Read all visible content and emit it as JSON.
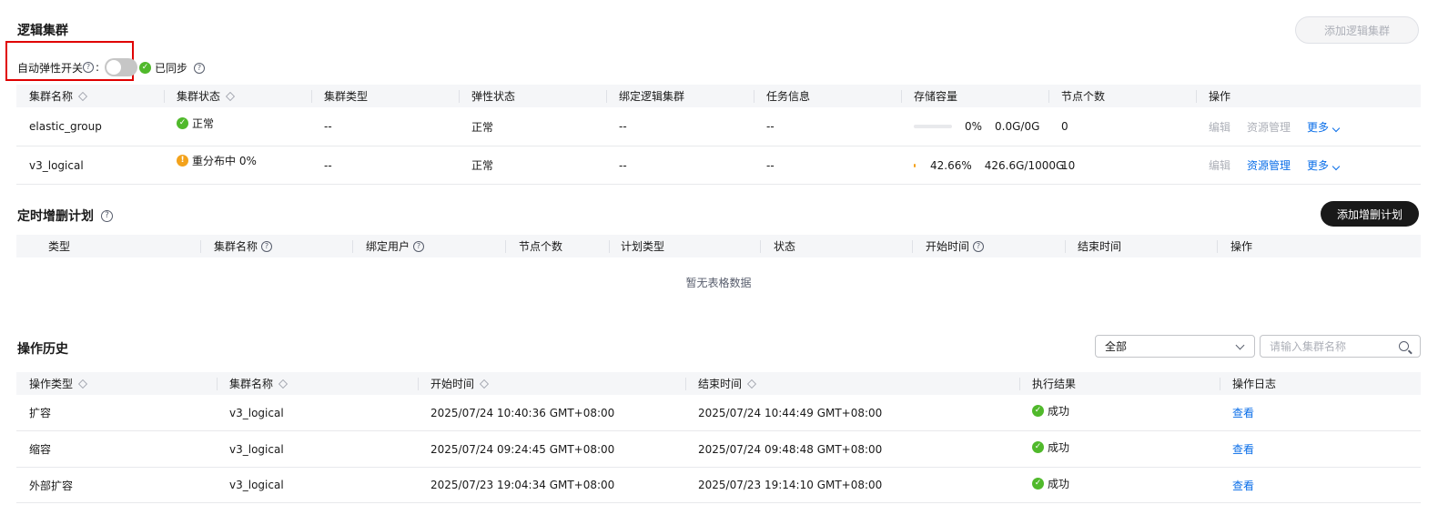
{
  "logical_cluster": {
    "title": "逻辑集群",
    "add_button": "添加逻辑集群",
    "auto_scaling_label": "自动弹性开关",
    "colon": ":",
    "sync_status": "已同步",
    "columns": [
      "集群名称",
      "集群状态",
      "集群类型",
      "弹性状态",
      "绑定逻辑集群",
      "任务信息",
      "存储容量",
      "节点个数",
      "操作"
    ],
    "rows": [
      {
        "name": "elastic_group",
        "status": "正常",
        "status_kind": "ok",
        "type": "--",
        "elastic_status": "正常",
        "bound": "--",
        "task": "--",
        "storage_percent": "0%",
        "storage_fraction": 0.0,
        "storage_amount": "0.0G/0G",
        "nodes": "0",
        "op_edit": "编辑",
        "op_resource": "资源管理",
        "op_more": "更多",
        "resource_enabled": false
      },
      {
        "name": "v3_logical",
        "status": "重分布中 0%",
        "status_kind": "warn",
        "type": "--",
        "elastic_status": "正常",
        "bound": "--",
        "task": "--",
        "storage_percent": "42.66%",
        "storage_fraction": 0.4266,
        "storage_amount": "426.6G/1000G",
        "nodes": "10",
        "op_edit": "编辑",
        "op_resource": "资源管理",
        "op_more": "更多",
        "resource_enabled": true
      }
    ]
  },
  "scheduled_plan": {
    "title": "定时增删计划",
    "add_button": "添加增删计划",
    "columns": [
      "类型",
      "集群名称",
      "绑定用户",
      "节点个数",
      "计划类型",
      "状态",
      "开始时间",
      "结束时间",
      "操作"
    ],
    "empty_text": "暂无表格数据"
  },
  "history": {
    "title": "操作历史",
    "filter_value": "全部",
    "search_placeholder": "请输入集群名称",
    "columns": [
      "操作类型",
      "集群名称",
      "开始时间",
      "结束时间",
      "执行结果",
      "操作日志"
    ],
    "rows": [
      {
        "op_type": "扩容",
        "cluster": "v3_logical",
        "start": "2025/07/24 10:40:36 GMT+08:00",
        "end": "2025/07/24 10:44:49 GMT+08:00",
        "result": "成功",
        "log": "查看"
      },
      {
        "op_type": "缩容",
        "cluster": "v3_logical",
        "start": "2025/07/24 09:24:45 GMT+08:00",
        "end": "2025/07/24 09:48:48 GMT+08:00",
        "result": "成功",
        "log": "查看"
      },
      {
        "op_type": "外部扩容",
        "cluster": "v3_logical",
        "start": "2025/07/23 19:04:34 GMT+08:00",
        "end": "2025/07/23 19:14:10 GMT+08:00",
        "result": "成功",
        "log": "查看"
      }
    ]
  },
  "colors": {
    "link": "#0a6ee8",
    "success": "#50b92b",
    "warning": "#f3a21b",
    "highlight_border": "#e00000"
  }
}
